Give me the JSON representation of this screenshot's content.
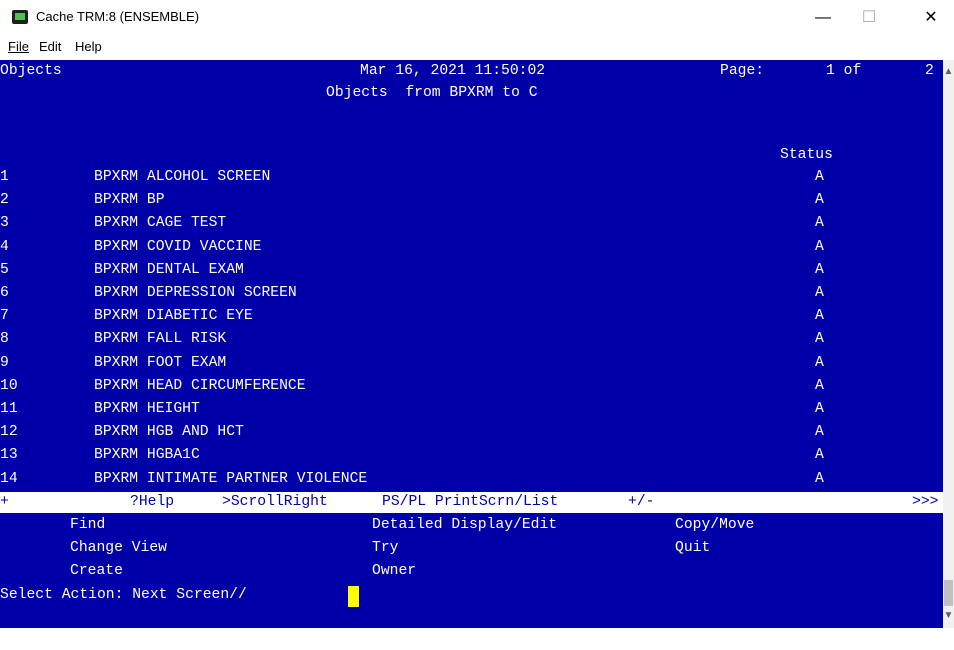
{
  "window": {
    "title": "Cache TRM:8 (ENSEMBLE)",
    "minimize": "—",
    "maximize": "☐",
    "close": "✕"
  },
  "menu": {
    "file": "File",
    "edit": "Edit",
    "help": "Help"
  },
  "header": {
    "section": "Objects",
    "datetime": "Mar 16, 2021 11:50:02",
    "page_label": "Page:",
    "page_num": "1 of",
    "page_total": "2",
    "subtitle": "Objects  from BPXRM to C",
    "status_col": "Status"
  },
  "rows": [
    {
      "num": "1",
      "name": "BPXRM ALCOHOL SCREEN",
      "status": "A"
    },
    {
      "num": "2",
      "name": "BPXRM BP",
      "status": "A"
    },
    {
      "num": "3",
      "name": "BPXRM CAGE TEST",
      "status": "A"
    },
    {
      "num": "4",
      "name": "BPXRM COVID VACCINE",
      "status": "A"
    },
    {
      "num": "5",
      "name": "BPXRM DENTAL EXAM",
      "status": "A"
    },
    {
      "num": "6",
      "name": "BPXRM DEPRESSION SCREEN",
      "status": "A"
    },
    {
      "num": "7",
      "name": "BPXRM DIABETIC EYE",
      "status": "A"
    },
    {
      "num": "8",
      "name": "BPXRM FALL RISK",
      "status": "A"
    },
    {
      "num": "9",
      "name": "BPXRM FOOT EXAM",
      "status": "A"
    },
    {
      "num": "10",
      "name": "BPXRM HEAD CIRCUMFERENCE",
      "status": "A"
    },
    {
      "num": "11",
      "name": "BPXRM HEIGHT",
      "status": "A"
    },
    {
      "num": "12",
      "name": "BPXRM HGB AND HCT",
      "status": "A"
    },
    {
      "num": "13",
      "name": "BPXRM HGBA1C",
      "status": "A"
    },
    {
      "num": "14",
      "name": "BPXRM INTIMATE PARTNER VIOLENCE",
      "status": "A"
    }
  ],
  "helpbar": {
    "plus": "+",
    "help": "?Help",
    "scroll_right": ">ScrollRight",
    "print": "PS/PL PrintScrn/List",
    "plusminus": "+/-",
    "more": ">>>"
  },
  "actions": {
    "find": "Find",
    "change_view": "Change View",
    "create": "Create",
    "detailed": "Detailed Display/Edit",
    "try": "Try",
    "owner": "Owner",
    "copy_move": "Copy/Move",
    "quit": "Quit"
  },
  "prompt": "Select Action: Next Screen// ",
  "colors": {
    "terminal_bg": "#0000a8",
    "terminal_fg": "#ffffff",
    "cursor": "#ffff00"
  }
}
